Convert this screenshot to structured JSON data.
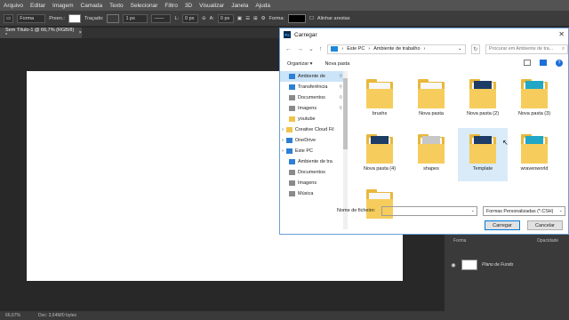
{
  "menubar": [
    "Arquivo",
    "Editar",
    "Imagem",
    "Camada",
    "Texto",
    "Selecionar",
    "Filtro",
    "3D",
    "Visualizar",
    "Janela",
    "Ajuda"
  ],
  "options": {
    "mode": "Forma",
    "fill_label": "Preen.:",
    "stroke_label": "Traçado:",
    "stroke_size": "1 px",
    "w_label": "L:",
    "w_value": "0 px",
    "h_label": "A:",
    "h_value": "0 px",
    "shape_label": "Forma:",
    "align_label": "Alinhar arestas"
  },
  "document": {
    "tab_title": "Sem Título-1 @ 66,7% (RGB/8) *",
    "zoom": "66,67%",
    "doc_info": "Doc: 3,64M/0 bytes"
  },
  "layers": {
    "header": "Forma",
    "opacity_label": "Opacidade",
    "layer_name": "Plano de Fundo"
  },
  "dialog": {
    "title": "Carregar",
    "address": [
      "Este PC",
      "Ambiente de trabalho"
    ],
    "search_placeholder": "Procurar em Ambiente de tra...",
    "organize": "Organizar ▾",
    "new_folder": "Nova pasta",
    "sidebar": [
      {
        "label": "Ambiente de",
        "icon": "desktop-icon",
        "selected": true,
        "pinned": true
      },
      {
        "label": "Transferência",
        "icon": "download-icon",
        "pinned": true
      },
      {
        "label": "Documentos",
        "icon": "documents-icon",
        "pinned": true
      },
      {
        "label": "Imagens",
        "icon": "pictures-icon",
        "pinned": true
      },
      {
        "label": "youtube",
        "icon": "folder-icon"
      },
      {
        "label": "Creative Cloud Fil",
        "icon": "creative-cloud-icon"
      },
      {
        "label": "OneDrive",
        "icon": "onedrive-icon"
      },
      {
        "label": "Este PC",
        "icon": "pc-icon"
      },
      {
        "label": "Ambiente de tra",
        "icon": "desktop-icon"
      },
      {
        "label": "Documentos",
        "icon": "documents-icon"
      },
      {
        "label": "Imagens",
        "icon": "pictures-icon"
      },
      {
        "label": "Música",
        "icon": "music-icon"
      }
    ],
    "items": [
      {
        "label": "brushs",
        "style": "plain"
      },
      {
        "label": "Nova pasta",
        "style": "plain"
      },
      {
        "label": "Nova pasta (2)",
        "style": "dark"
      },
      {
        "label": "Nova pasta (3)",
        "style": "teal"
      },
      {
        "label": "Nova pasta (4)",
        "style": "dark"
      },
      {
        "label": "shapes",
        "style": "grey"
      },
      {
        "label": "Template",
        "style": "dark",
        "selected": true
      },
      {
        "label": "wravenworld",
        "style": "teal"
      },
      {
        "label": "",
        "style": "plain"
      }
    ],
    "filename_label": "Nome de ficheiro:",
    "filename_value": "",
    "filter": "Formas Personalizadas (*.CSH)",
    "load_button": "Carregar",
    "cancel_button": "Cancelar"
  }
}
